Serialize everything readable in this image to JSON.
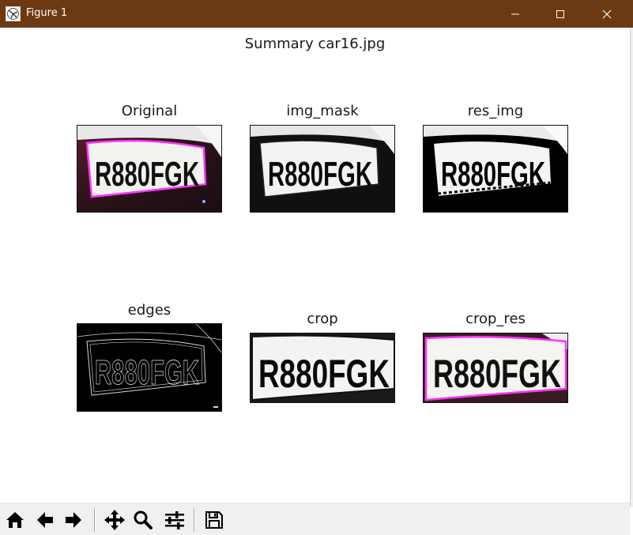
{
  "window": {
    "title": "Figure 1",
    "controls": [
      "minimize-icon",
      "maximize-icon",
      "close-icon"
    ]
  },
  "figure": {
    "suptitle": "Summary car16.jpg",
    "plate_text": "R880FGK",
    "panels": [
      {
        "title": "Original",
        "style": "color-photo-magenta-outline"
      },
      {
        "title": "img_mask",
        "style": "grayscale-threshold"
      },
      {
        "title": "res_img",
        "style": "binarized"
      },
      {
        "title": "edges",
        "style": "edge-detection"
      },
      {
        "title": "crop",
        "style": "cropped-threshold"
      },
      {
        "title": "crop_res",
        "style": "cropped-magenta-outline"
      }
    ]
  },
  "toolbar": {
    "buttons": [
      {
        "icon": "home-icon",
        "tooltip": "Reset original view"
      },
      {
        "icon": "back-arrow-icon",
        "tooltip": "Back"
      },
      {
        "icon": "forward-arrow-icon",
        "tooltip": "Forward"
      },
      {
        "icon": "pan-move-icon",
        "tooltip": "Pan"
      },
      {
        "icon": "zoom-magnifier-icon",
        "tooltip": "Zoom"
      },
      {
        "icon": "subplots-sliders-icon",
        "tooltip": "Configure subplots"
      },
      {
        "icon": "save-floppy-icon",
        "tooltip": "Save"
      }
    ]
  },
  "colors": {
    "titlebar": "#6b3a12",
    "highlight": "#ff33ff",
    "toolbar": "#f0f0f0"
  }
}
